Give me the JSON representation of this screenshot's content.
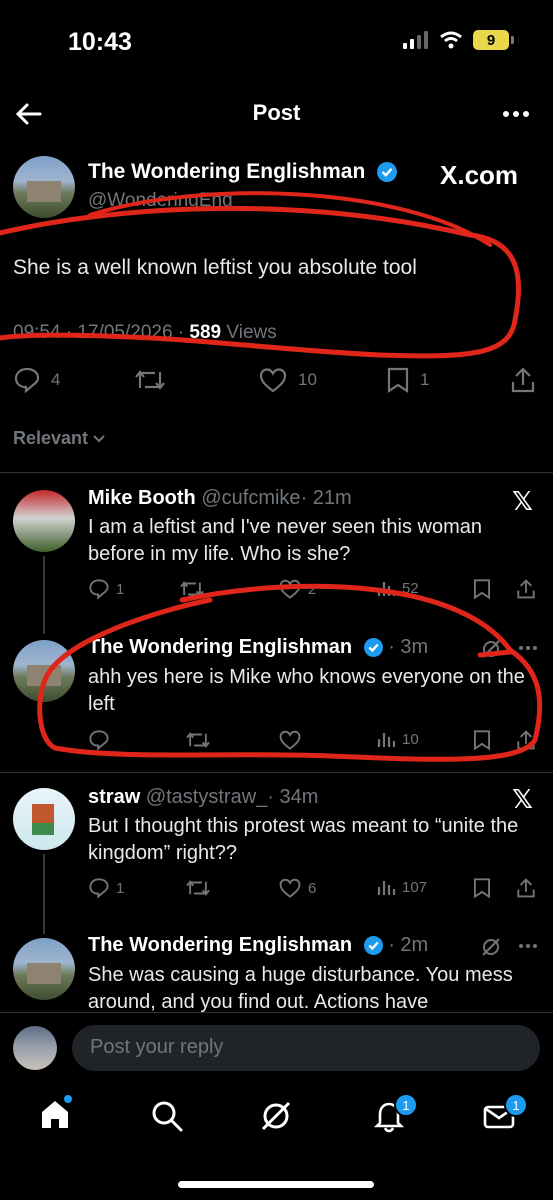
{
  "status_bar": {
    "time": "10:43",
    "battery": "9"
  },
  "header": {
    "title": "Post"
  },
  "post": {
    "author": "The Wondering Englishman",
    "handle": "@WonderingEng",
    "watermark": "X.com",
    "text": "She is a well known leftist you absolute tool",
    "timestamp": "09:54 · 17/05/2026 · ",
    "views_count": "589",
    "views_label": "Views",
    "stats": {
      "replies": "4",
      "reposts": "",
      "likes": "10",
      "bookmarks": "1"
    }
  },
  "filter": {
    "label": "Relevant"
  },
  "replies": [
    {
      "author": "Mike Booth",
      "handle": "@cufcmike",
      "time": "· 21m",
      "text": "I am a leftist and I've never seen this woman before in my life. Who is she?",
      "stats": {
        "replies": "1",
        "reposts": "",
        "likes": "2",
        "views": "52"
      }
    },
    {
      "author": "The Wondering Englishman",
      "handle": "",
      "time": "· 3m",
      "text": "ahh yes here is Mike who knows everyone on the left",
      "stats": {
        "replies": "",
        "reposts": "",
        "likes": "",
        "views": "10"
      }
    },
    {
      "author": "straw",
      "handle": "@tastystraw_",
      "time": "· 34m",
      "text": "But I thought this protest was meant to “unite the kingdom” right??",
      "stats": {
        "replies": "1",
        "reposts": "",
        "likes": "6",
        "views": "107"
      }
    },
    {
      "author": "The Wondering Englishman",
      "handle": "",
      "time": "· 2m",
      "text": "She was causing a huge disturbance. You mess around, and you find out.  Actions have"
    }
  ],
  "composer": {
    "placeholder": "Post your reply"
  },
  "tabbar": {
    "notifications_badge": "1",
    "messages_badge": "1"
  },
  "colors": {
    "annotation": "#e0261b",
    "accent": "#1d9bf0"
  }
}
